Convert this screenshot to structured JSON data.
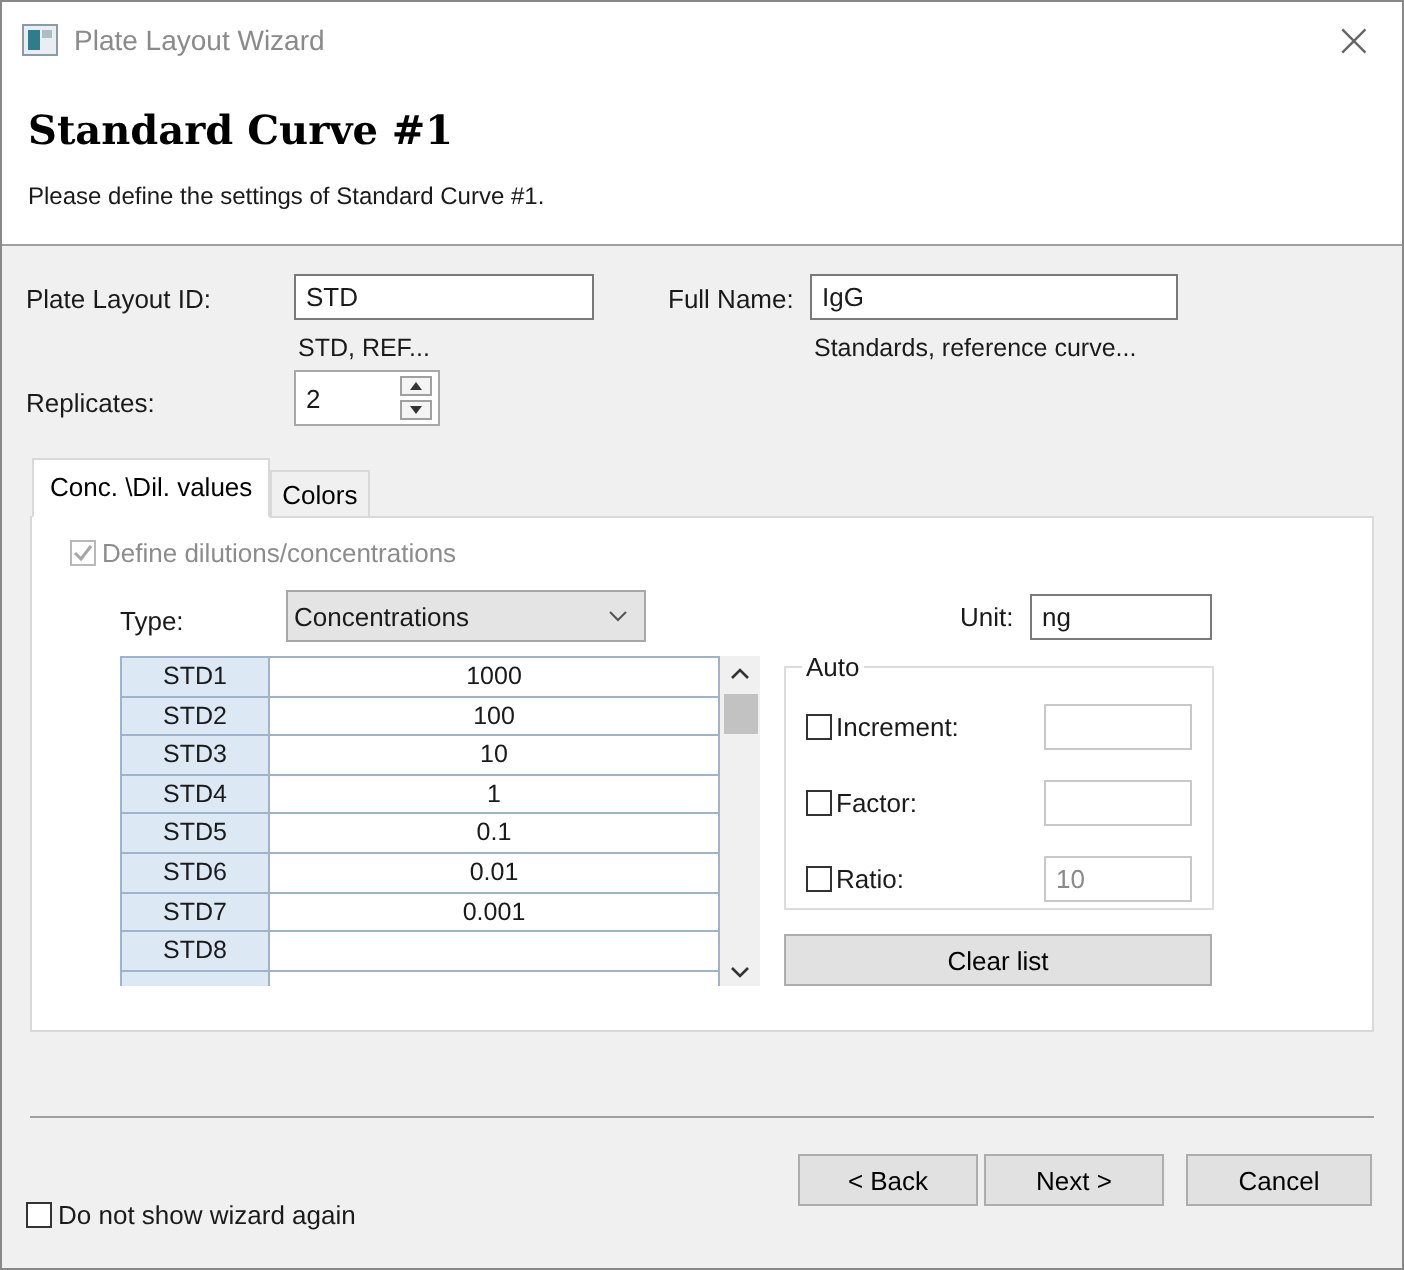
{
  "window": {
    "title": "Plate Layout Wizard",
    "close": "×"
  },
  "header": {
    "title": "Standard Curve #1",
    "subtitle": "Please define the settings of Standard Curve #1."
  },
  "plate_layout_id": {
    "label": "Plate Layout ID:",
    "value": "STD",
    "hint": "STD, REF..."
  },
  "full_name": {
    "label": "Full Name:",
    "value": "IgG",
    "hint": "Standards, reference curve..."
  },
  "replicates": {
    "label": "Replicates:",
    "value": "2"
  },
  "tabs": [
    {
      "label": "Conc. \\Dil. values",
      "selected": true
    },
    {
      "label": "Colors",
      "selected": false
    }
  ],
  "define": {
    "label": "Define dilutions/concentrations",
    "checked": true,
    "disabled": true
  },
  "type": {
    "label": "Type:",
    "value": "Concentrations"
  },
  "unit": {
    "label": "Unit:",
    "value": "ng"
  },
  "table": {
    "rows": [
      {
        "name": "STD1",
        "value": "1000"
      },
      {
        "name": "STD2",
        "value": "100"
      },
      {
        "name": "STD3",
        "value": "10"
      },
      {
        "name": "STD4",
        "value": "1"
      },
      {
        "name": "STD5",
        "value": "0.1"
      },
      {
        "name": "STD6",
        "value": "0.01"
      },
      {
        "name": "STD7",
        "value": "0.001"
      },
      {
        "name": "STD8"
      }
    ]
  },
  "auto": {
    "title": "Auto",
    "options": [
      {
        "label": "Increment:",
        "checked": false
      },
      {
        "label": "Factor:",
        "checked": false
      },
      {
        "label": "Ratio:",
        "checked": false,
        "value": "10"
      }
    ]
  },
  "clear_button": "Clear list",
  "buttons": [
    "< Back",
    "Next >",
    "Cancel"
  ],
  "dont_show": {
    "label": "Do not show wizard again",
    "checked": false
  }
}
